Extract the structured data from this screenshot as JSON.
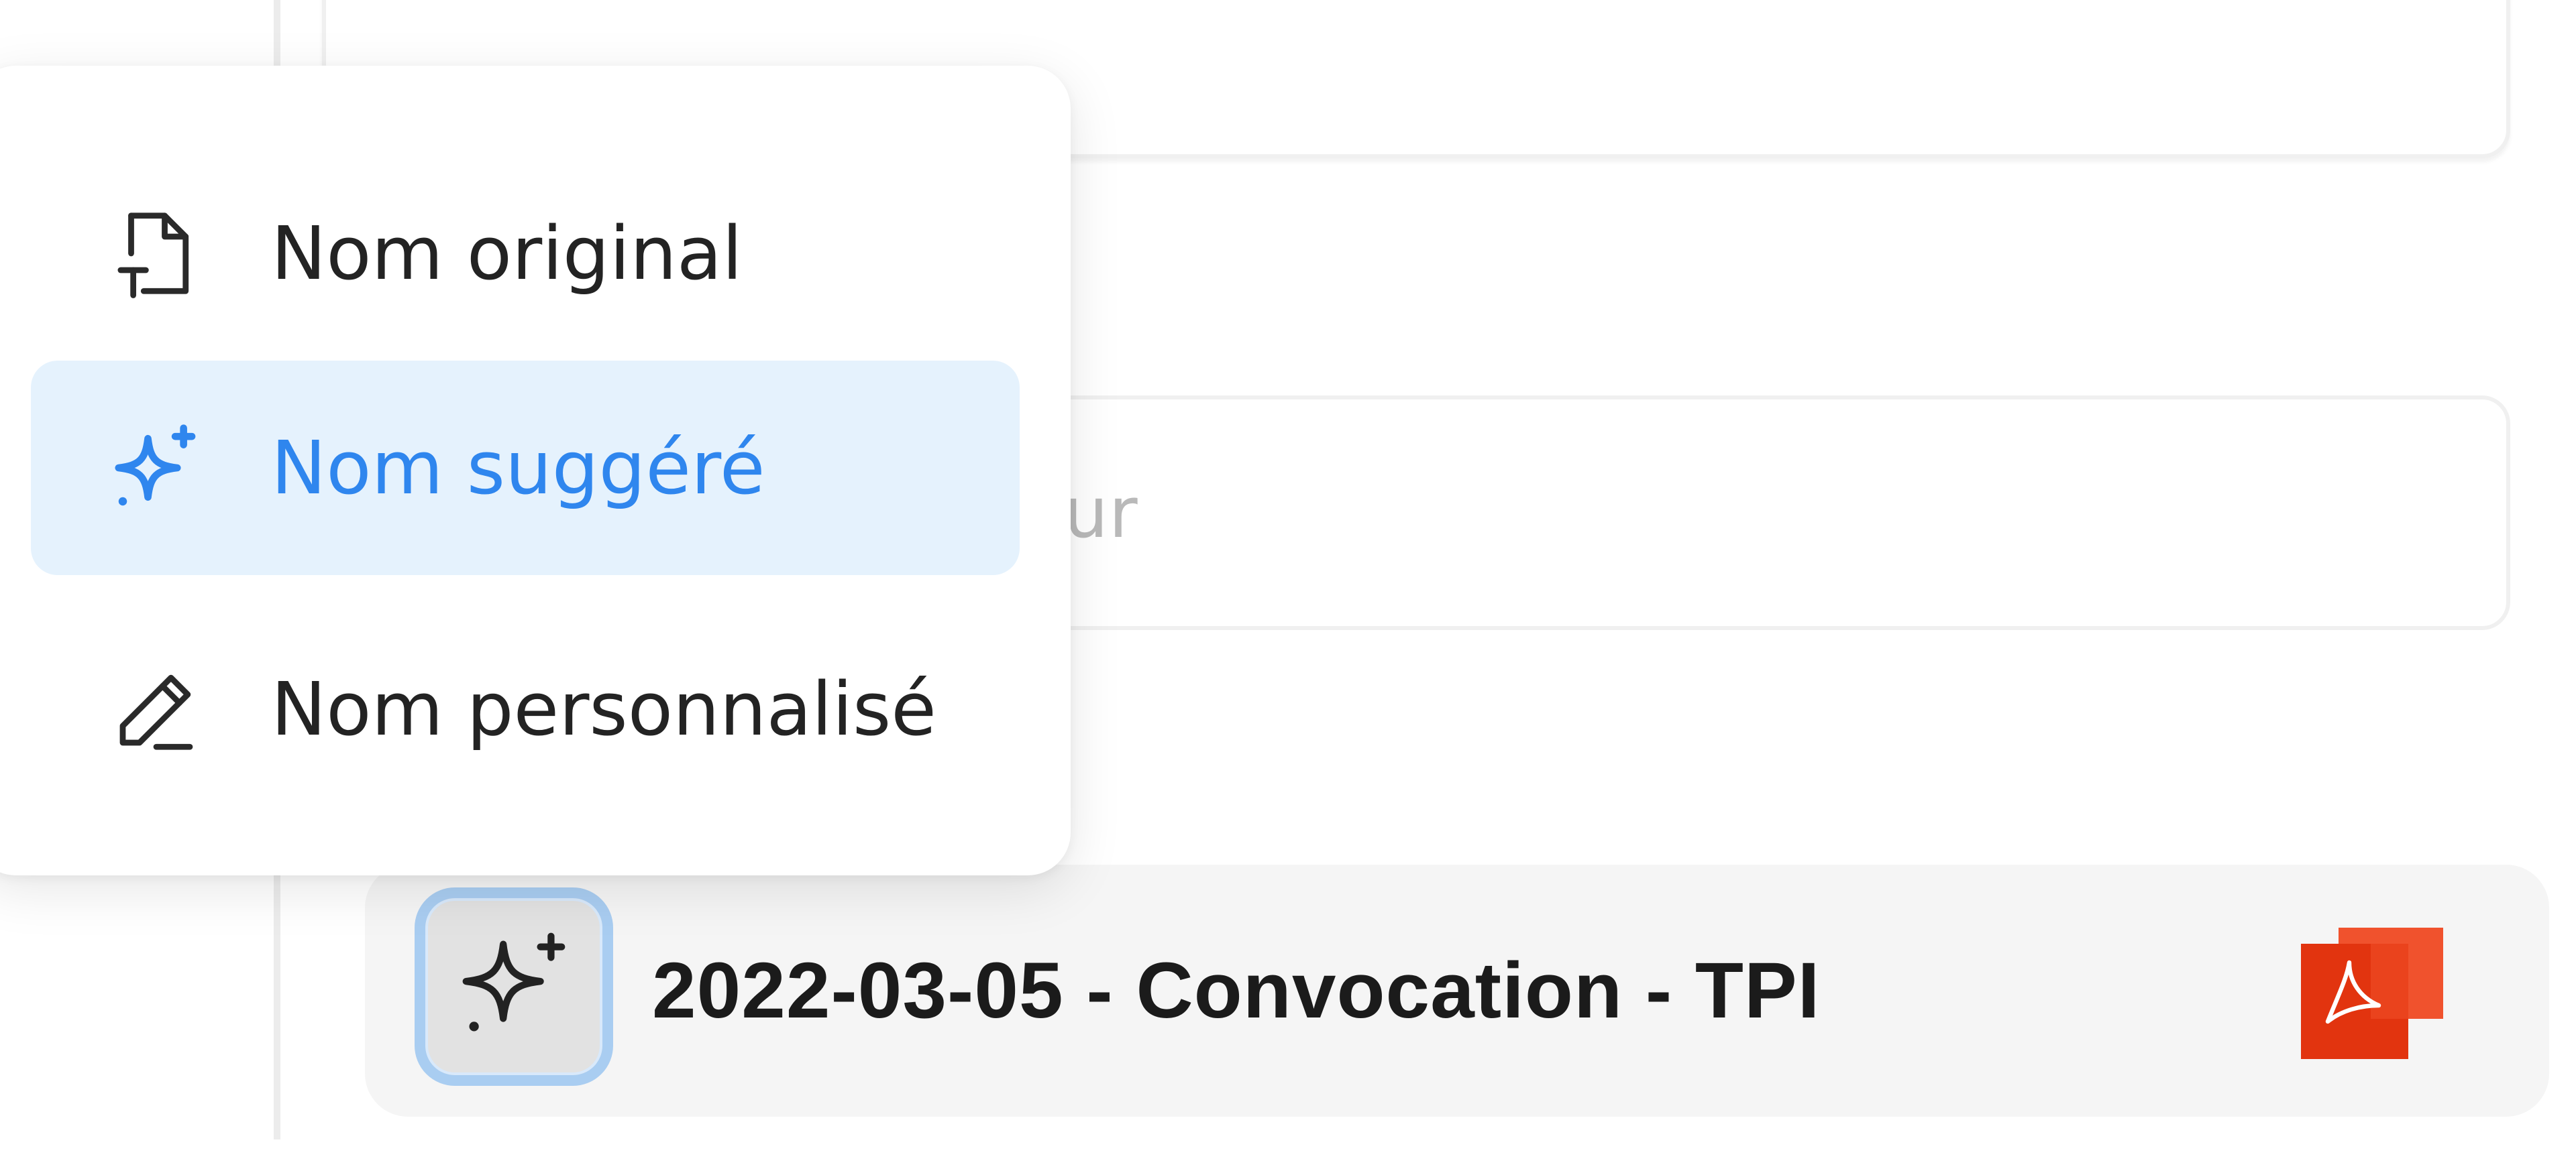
{
  "menu": {
    "items": [
      {
        "label": "Nom original",
        "icon": "file-text-icon",
        "selected": false
      },
      {
        "label": "Nom suggéré",
        "icon": "sparkles-icon",
        "selected": true
      },
      {
        "label": "Nom personnalisé",
        "icon": "pencil-icon",
        "selected": false
      }
    ]
  },
  "form": {
    "name_field_placeholder_visible": "ur"
  },
  "file": {
    "name": "2022-03-05 - Convocation - TPI",
    "type_icon": "pdf-icon",
    "naming_mode_icon": "sparkles-icon"
  },
  "colors": {
    "accent": "#2f86ee",
    "selected_bg": "#e5f2fd",
    "pdf_red": "#e2340f",
    "focus_ring": "#a9cdf1"
  }
}
